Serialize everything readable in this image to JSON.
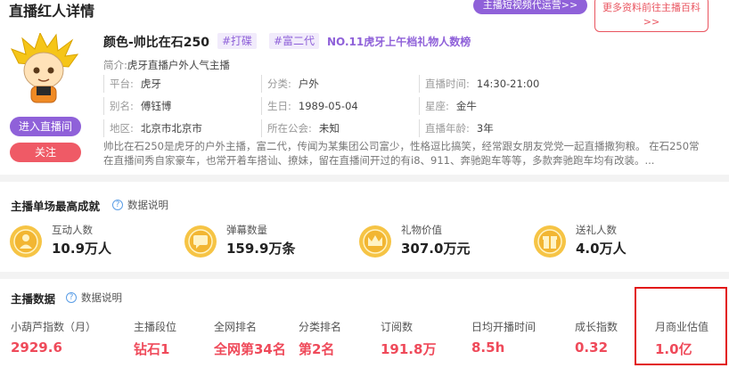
{
  "header": {
    "title": "直播红人详情",
    "promo_label": "主播短视频代运营>>",
    "more_label": "更多资料前往主播百科 >>"
  },
  "profile": {
    "name": "颜色-帅比在石250",
    "tags": [
      "#打碟",
      "#富二代"
    ],
    "rank_text": "NO.11虎牙上午档礼物人数榜",
    "intro_label": "简介:",
    "intro_value": "虎牙直播户外人气主播",
    "enter_label": "进入直播间",
    "follow_label": "关注",
    "info": {
      "platform_label": "平台:",
      "platform": "虎牙",
      "category_label": "分类:",
      "category": "户外",
      "live_time_label": "直播时间:",
      "live_time": "14:30-21:00",
      "alias_label": "别名:",
      "alias": "傅钰博",
      "birthday_label": "生日:",
      "birthday": "1989-05-04",
      "zodiac_label": "星座:",
      "zodiac": "金牛",
      "region_label": "地区:",
      "region": "北京市北京市",
      "guild_label": "所在公会:",
      "guild": "未知",
      "years_label": "直播年龄:",
      "years": "3年"
    },
    "bio": "帅比在石250是虎牙的户外主播，富二代，传闻为某集团公司富少，性格逗比搞笑，经常跟女朋友党党一起直播撒狗粮。 在石250常在直播间秀自家豪车，也常开着车搭讪、撩妹，留在直播间开过的有i8、911、奔驰跑车等等，多款奔驰跑车均有改装。..."
  },
  "achievements": {
    "title": "主播单场最高成就",
    "help_label": "数据说明",
    "items": [
      {
        "label": "互动人数",
        "value": "10.9万人",
        "icon": "medal-people-icon"
      },
      {
        "label": "弹幕数量",
        "value": "159.9万条",
        "icon": "medal-chat-icon"
      },
      {
        "label": "礼物价值",
        "value": "307.0万元",
        "icon": "medal-crown-icon"
      },
      {
        "label": "送礼人数",
        "value": "4.0万人",
        "icon": "medal-gift-icon"
      }
    ]
  },
  "stats": {
    "title": "主播数据",
    "help_label": "数据说明",
    "items": [
      {
        "label": "小葫芦指数（月）",
        "value": "2929.6"
      },
      {
        "label": "主播段位",
        "value": "钻石1"
      },
      {
        "label": "全网排名",
        "value": "全网第34名"
      },
      {
        "label": "分类排名",
        "value": "第2名"
      },
      {
        "label": "订阅数",
        "value": "191.8万"
      },
      {
        "label": "日均开播时间",
        "value": "8.5h"
      },
      {
        "label": "成长指数",
        "value": "0.32"
      },
      {
        "label": "月商业估值",
        "value": "1.0亿"
      }
    ]
  },
  "colors": {
    "purple": "#8f61d9",
    "red": "#ef4a5a",
    "gold": "#f2b632",
    "highlight": "#e21818"
  }
}
